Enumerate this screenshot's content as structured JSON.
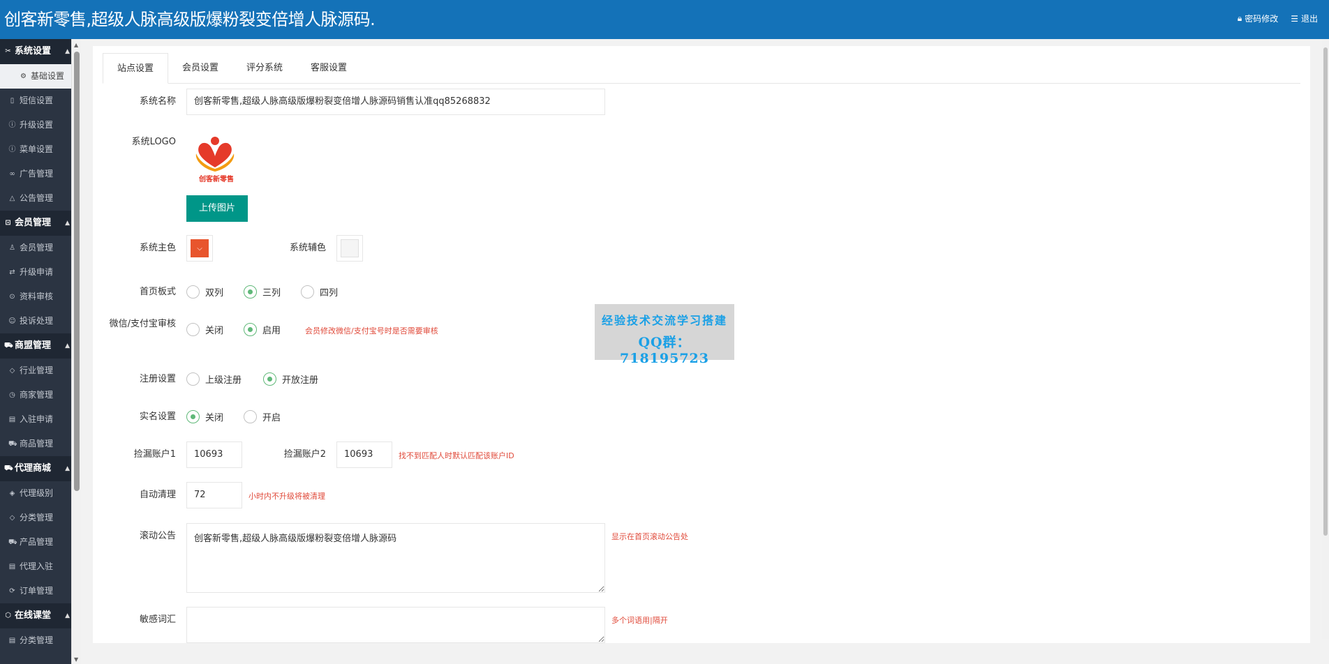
{
  "header": {
    "title": "创客新零售,超级人脉高级版爆粉裂变倍增人脉源码.",
    "change_password": "密码修改",
    "logout": "退出"
  },
  "sidebar": {
    "groups": [
      {
        "label": "系统设置",
        "items": [
          "基础设置",
          "短信设置",
          "升级设置",
          "菜单设置",
          "广告管理",
          "公告管理"
        ]
      },
      {
        "label": "会员管理",
        "items": [
          "会员管理",
          "升级申请",
          "资料审核",
          "投诉处理"
        ]
      },
      {
        "label": "商盟管理",
        "items": [
          "行业管理",
          "商家管理",
          "入驻申请",
          "商品管理"
        ]
      },
      {
        "label": "代理商城",
        "items": [
          "代理级别",
          "分类管理",
          "产品管理",
          "代理入驻",
          "订单管理"
        ]
      },
      {
        "label": "在线课堂",
        "items": [
          "分类管理"
        ]
      }
    ]
  },
  "tabs": [
    "站点设置",
    "会员设置",
    "评分系统",
    "客服设置"
  ],
  "form": {
    "system_name": {
      "label": "系统名称",
      "value": "创客新零售,超级人脉高级版爆粉裂变倍增人脉源码销售认准qq85268832"
    },
    "logo": {
      "label": "系统LOGO",
      "caption": "创客新零售",
      "upload": "上传图片"
    },
    "primary_color": {
      "label": "系统主色",
      "value": "#e8552d"
    },
    "secondary_color": {
      "label": "系统辅色",
      "value": "#f5f5f5"
    },
    "home_layout": {
      "label": "首页板式",
      "options": [
        "双列",
        "三列",
        "四列"
      ],
      "selected": 1
    },
    "wechat_review": {
      "label": "微信/支付宝审核",
      "options": [
        "关闭",
        "启用"
      ],
      "selected": 1,
      "hint": "会员修改微信/支付宝号时是否需要审核"
    },
    "register": {
      "label": "注册设置",
      "options": [
        "上级注册",
        "开放注册"
      ],
      "selected": 1
    },
    "realname": {
      "label": "实名设置",
      "options": [
        "关闭",
        "开启"
      ],
      "selected": 0
    },
    "pick_account1": {
      "label": "捡漏账户1",
      "value": "10693"
    },
    "pick_account2": {
      "label": "捡漏账户2",
      "value": "10693",
      "hint": "找不到匹配人时默认匹配该账户ID"
    },
    "auto_clean": {
      "label": "自动清理",
      "value": "72",
      "hint": "小时内不升级将被清理"
    },
    "notice": {
      "label": "滚动公告",
      "value": "创客新零售,超级人脉高级版爆粉裂变倍增人脉源码",
      "hint": "显示在首页滚动公告处"
    },
    "sensitive": {
      "label": "敏感词汇",
      "value": "",
      "hint": "多个词语用|隔开"
    }
  },
  "watermark": {
    "line1": "经验技术交流学习搭建",
    "line2": "QQ群：718195723"
  }
}
